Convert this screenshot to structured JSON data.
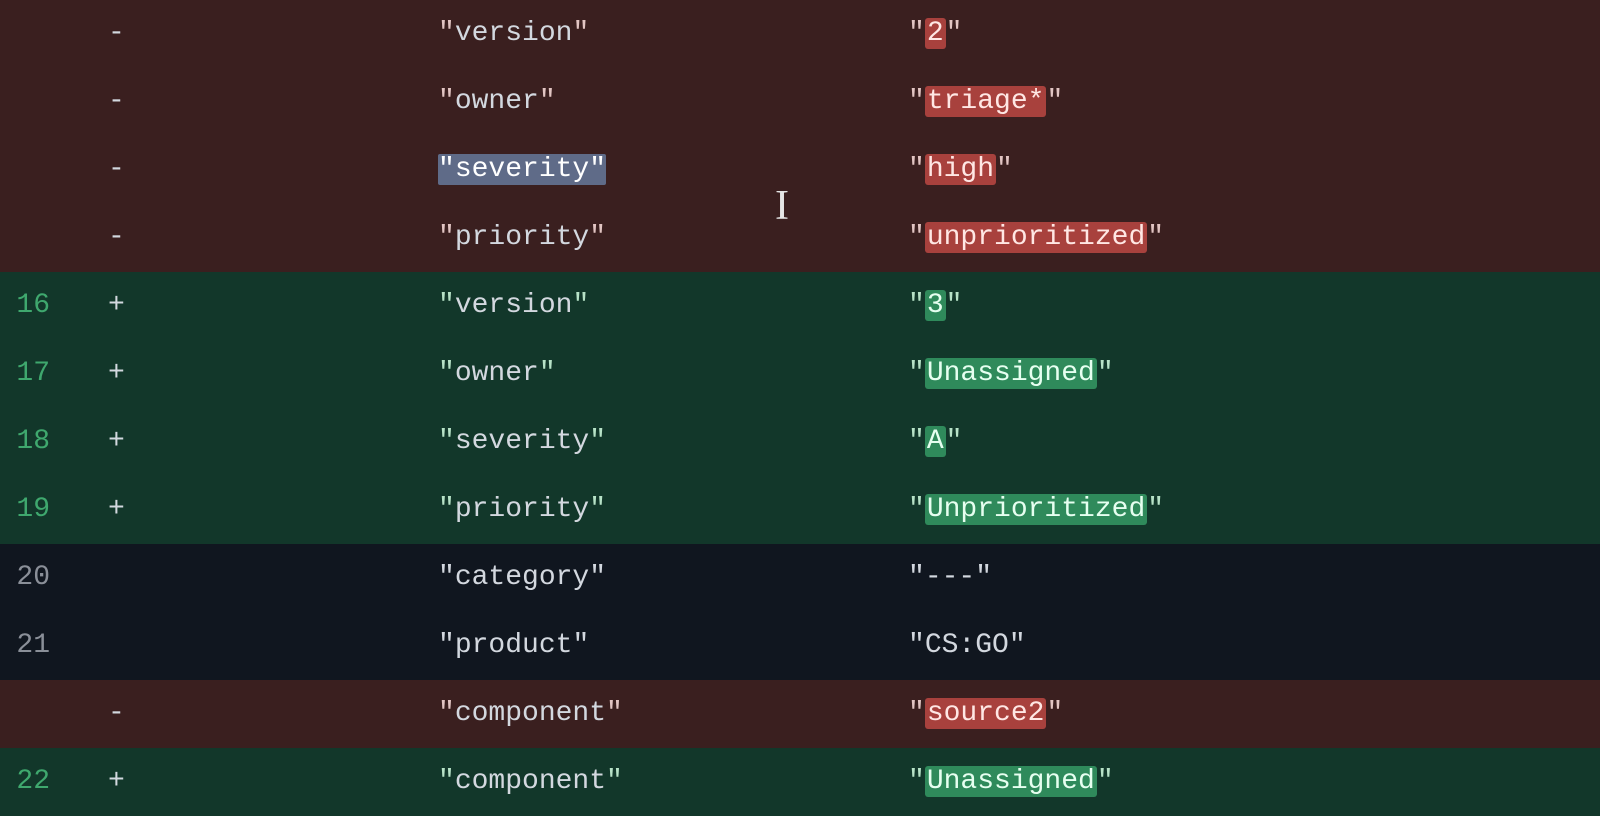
{
  "lines": [
    {
      "type": "removed",
      "lineno": "",
      "sign": "-",
      "key": "version",
      "keySelected": false,
      "value": "2",
      "valHighlight": "del",
      "valHighlightFull": true
    },
    {
      "type": "removed",
      "lineno": "",
      "sign": "-",
      "key": "owner",
      "keySelected": false,
      "value": "triage*",
      "valHighlight": "del",
      "valHighlightFull": true
    },
    {
      "type": "removed",
      "lineno": "",
      "sign": "-",
      "key": "severity",
      "keySelected": true,
      "value": "high",
      "valHighlight": "del",
      "valHighlightFull": false
    },
    {
      "type": "removed",
      "lineno": "",
      "sign": "-",
      "key": "priority",
      "keySelected": false,
      "value": "unprioritized",
      "valHighlight": "del",
      "valHighlightFull": true
    },
    {
      "type": "added",
      "lineno": "16",
      "sign": "+",
      "key": "version",
      "keySelected": false,
      "value": "3",
      "valHighlight": "add",
      "valHighlightFull": true
    },
    {
      "type": "added",
      "lineno": "17",
      "sign": "+",
      "key": "owner",
      "keySelected": false,
      "value": "Unassigned",
      "valHighlight": "add",
      "valHighlightFull": true
    },
    {
      "type": "added",
      "lineno": "18",
      "sign": "+",
      "key": "severity",
      "keySelected": false,
      "value": "A",
      "valHighlight": "add",
      "valHighlightFull": true
    },
    {
      "type": "added",
      "lineno": "19",
      "sign": "+",
      "key": "priority",
      "keySelected": false,
      "value": "Unprioritized",
      "valHighlight": "add",
      "valHighlightFull": true
    },
    {
      "type": "context",
      "lineno": "20",
      "sign": " ",
      "key": "category",
      "keySelected": false,
      "value": "---",
      "valHighlight": "",
      "valHighlightFull": false
    },
    {
      "type": "context",
      "lineno": "21",
      "sign": " ",
      "key": "product",
      "keySelected": false,
      "value": "CS:GO",
      "valHighlight": "",
      "valHighlightFull": false
    },
    {
      "type": "removed",
      "lineno": "",
      "sign": "-",
      "key": "component",
      "keySelected": false,
      "value": "source2",
      "valHighlight": "del",
      "valHighlightFull": true
    },
    {
      "type": "added",
      "lineno": "22",
      "sign": "+",
      "key": "component",
      "keySelected": false,
      "value": "Unassigned",
      "valHighlight": "add",
      "valHighlightFull": true
    }
  ],
  "cursorGlyph": "I"
}
